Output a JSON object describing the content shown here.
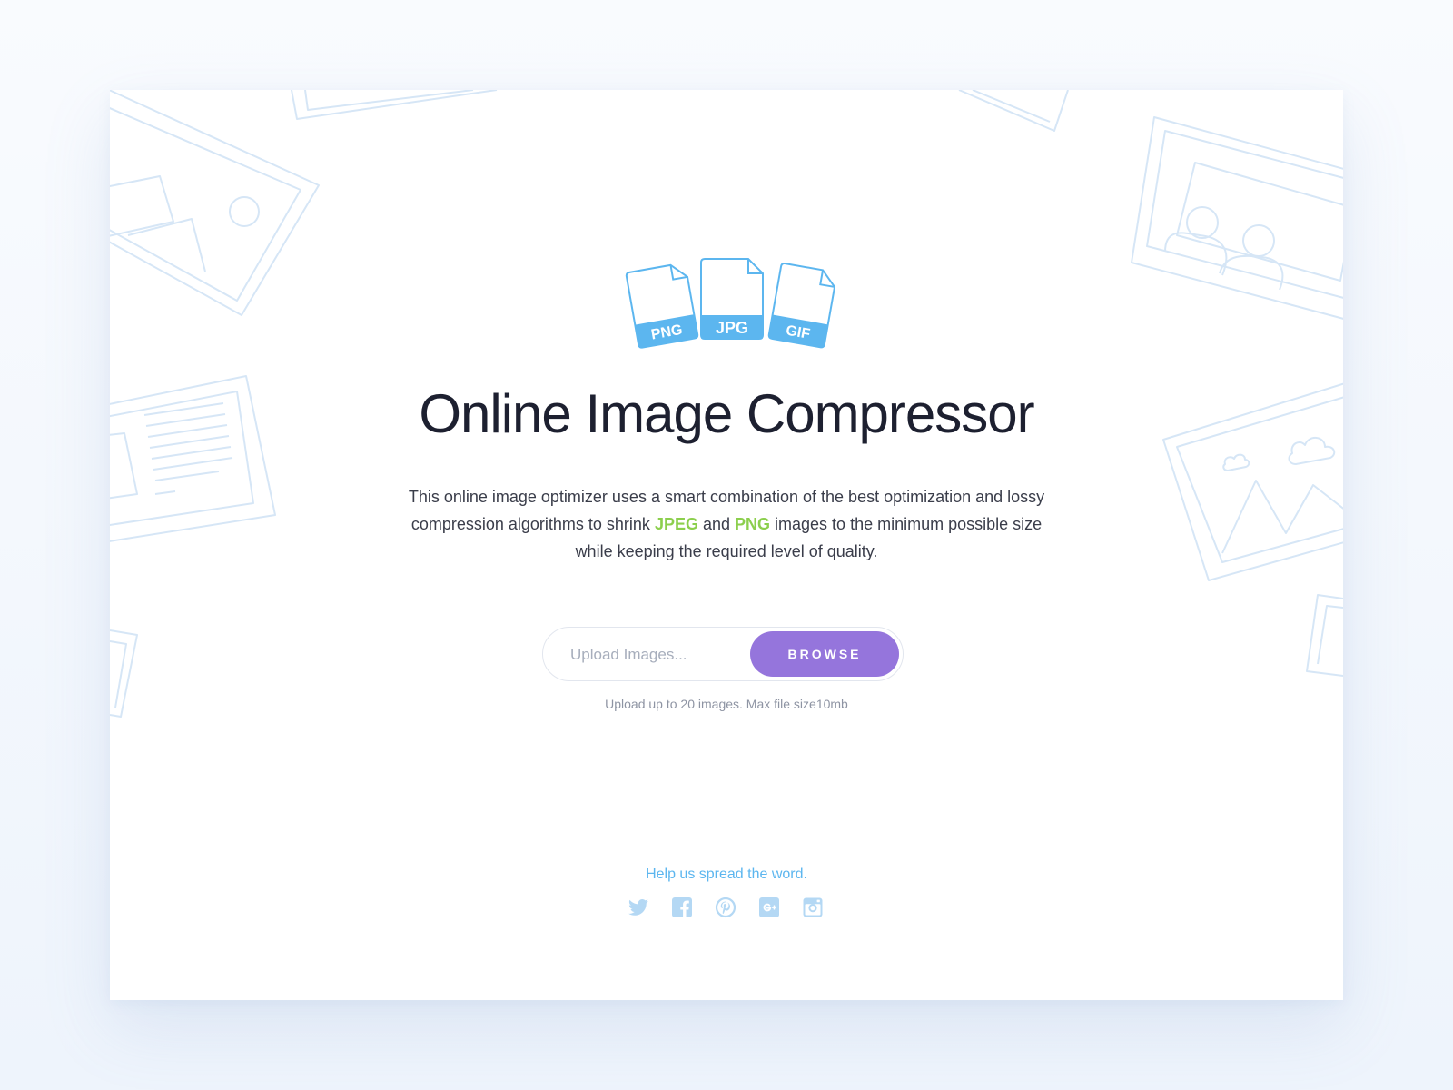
{
  "page": {
    "title": "Online Image Compressor",
    "description": {
      "before": "This online image optimizer uses a smart combination of the best optimization and lossy compression algorithms to shrink ",
      "highlight_1": "JPEG",
      "between": " and ",
      "highlight_2": "PNG",
      "after": " images to the minimum possible size while keeping the required level of quality."
    }
  },
  "file_icons": [
    {
      "label": "PNG",
      "icon": "png-file-icon"
    },
    {
      "label": "JPG",
      "icon": "jpg-file-icon"
    },
    {
      "label": "GIF",
      "icon": "gif-file-icon"
    }
  ],
  "upload": {
    "placeholder": "Upload Images...",
    "browse_label": "BROWSE",
    "note": "Upload up to 20 images. Max file size10mb"
  },
  "footer": {
    "spread_text": "Help us spread the word.",
    "social_icons": [
      "twitter-icon",
      "facebook-icon",
      "pinterest-icon",
      "google-plus-icon",
      "instagram-icon"
    ]
  },
  "colors": {
    "accent_purple": "#9575dc",
    "icon_blue": "#5cb6ef",
    "highlight_green": "#8ccf4d",
    "background_art": "#d6e6f6",
    "social_icons": "#b4d8f4"
  }
}
